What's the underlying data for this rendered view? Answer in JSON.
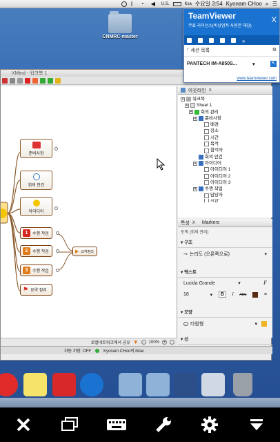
{
  "menubar": {
    "flag": "U.S.",
    "battery": "Ksa",
    "time": "수요일 3:54",
    "user": "Kyonam CHoo"
  },
  "desktop": {
    "folder_label": "CNMRC-master"
  },
  "teamviewer": {
    "title": "TeamViewer",
    "subtitle": "무료 라이선스(비상업적 사용만 해당)",
    "close": "X",
    "session_list": "세션 목록",
    "device": "PANTECH IM-A850S...",
    "link": "www.teamviewer.com"
  },
  "xmind": {
    "window_title": "XMind - 워크북 1",
    "nodes": {
      "prep": "준비사항",
      "agenda": "회의 안건",
      "ideas": "아이디어",
      "task1": "수행 작업",
      "task2": "수행 작업",
      "task3": "수행 작업",
      "summary_link": "요약정리",
      "summary": "요약 정리"
    },
    "task_numbers": [
      "1",
      "2",
      "3"
    ],
    "canvas_status": "로컬네트워크에서 공유",
    "zoom": "100%",
    "autosave": "자동 저장: OFF",
    "account": "Kyonam CHoo의 iMac",
    "outline_tab": "아웃라인",
    "outline_tab_x": "X",
    "tree": [
      {
        "label": "워크북",
        "icon": "workbook"
      },
      {
        "label": "Sheet 1",
        "icon": "sheet"
      },
      {
        "label": "회의 관리",
        "icon": "central"
      },
      {
        "label": "준비사항",
        "icon": "main"
      },
      {
        "label": "배경",
        "icon": "sub"
      },
      {
        "label": "장소",
        "icon": "sub"
      },
      {
        "label": "시간",
        "icon": "sub"
      },
      {
        "label": "목적",
        "icon": "sub"
      },
      {
        "label": "참석자",
        "icon": "sub"
      },
      {
        "label": "회의 안건",
        "icon": "main"
      },
      {
        "label": "아이디어",
        "icon": "main"
      },
      {
        "label": "아이디어 1",
        "icon": "sub"
      },
      {
        "label": "아이디어 2",
        "icon": "sub"
      },
      {
        "label": "아이디어 3",
        "icon": "sub"
      },
      {
        "label": "수행 작업",
        "icon": "main"
      },
      {
        "label": "담당자",
        "icon": "sub"
      },
      {
        "label": "시한",
        "icon": "sub"
      }
    ],
    "props": {
      "tab1": "특성",
      "tab1_x": "X",
      "tab2": "Markers",
      "subtitle": "토픽 (회의 관리)",
      "structure_label": "구조",
      "structure_value": "논리도 (오른쪽으로)",
      "text_label": "텍스트",
      "font": "Lucida Grande",
      "font_size": "18",
      "bold": "B",
      "italic": "I",
      "abc": "ABC",
      "shape_label": "모양",
      "shape_value": "타원형",
      "line_label": "선"
    }
  },
  "colors": {
    "accent": "#1a73d1",
    "topic_border": "#8a5a2b",
    "task_orange": "#e07b1a",
    "task_red": "#d7261e"
  },
  "controls": [
    "close-icon",
    "monitor-icon",
    "keyboard-icon",
    "wrench-icon",
    "gear-icon",
    "hide-icon"
  ]
}
